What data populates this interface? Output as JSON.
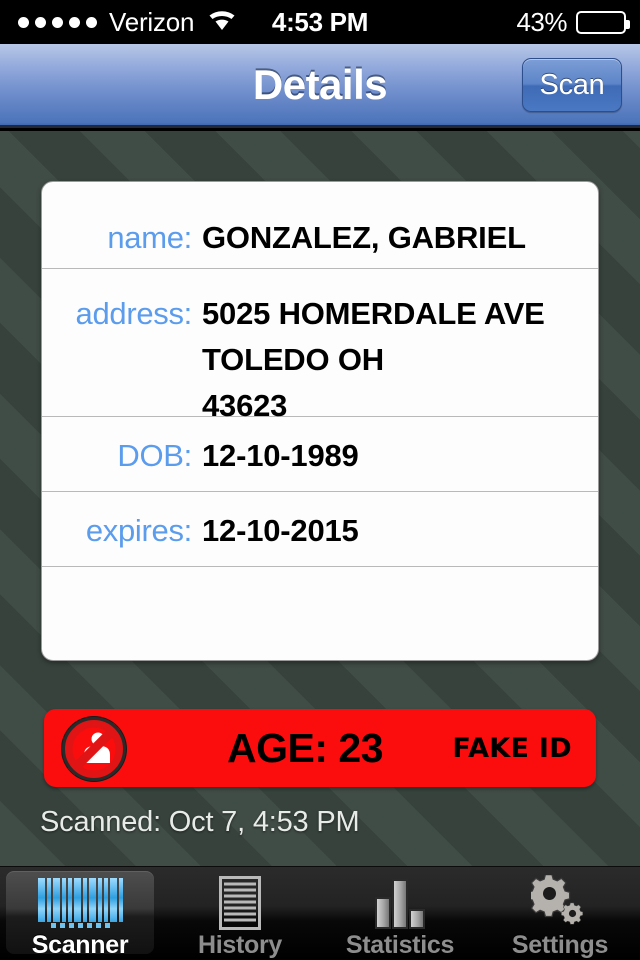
{
  "status_bar": {
    "signal_dots": 5,
    "carrier": "Verizon",
    "wifi_icon": "wifi-icon",
    "time": "4:53 PM",
    "battery_percent": "43%",
    "battery_level": 43
  },
  "nav_bar": {
    "title": "Details",
    "scan_label": "Scan"
  },
  "detail_card": {
    "rows": [
      {
        "label": "name:",
        "value_lines": [
          "GONZALEZ, GABRIEL"
        ]
      },
      {
        "label": "address:",
        "value_lines": [
          "5025 HOMERDALE AVE",
          "TOLEDO OH",
          "43623"
        ]
      },
      {
        "label": "DOB:",
        "value_lines": [
          "12-10-1989"
        ]
      },
      {
        "label": "expires:",
        "value_lines": [
          "12-10-2015"
        ]
      }
    ]
  },
  "alert_banner": {
    "icon": "no-entry-person-icon",
    "age_text": "AGE: 23",
    "flag_text": "FAKE ID",
    "background_color": "#FB0D0D"
  },
  "scanned_at": "Scanned: Oct 7, 4:53 PM",
  "tab_bar": {
    "items": [
      {
        "label": "Scanner",
        "icon": "barcode-icon",
        "selected": true
      },
      {
        "label": "History",
        "icon": "list-lines-icon",
        "selected": false
      },
      {
        "label": "Statistics",
        "icon": "bar-chart-icon",
        "selected": false
      },
      {
        "label": "Settings",
        "icon": "gears-icon",
        "selected": false
      }
    ]
  },
  "colors": {
    "label_blue": "#5C9CED",
    "alert_red": "#FB0D0D",
    "background": "#39453F",
    "nav_top": "#B7C7E6",
    "nav_bottom": "#4C74BA"
  }
}
